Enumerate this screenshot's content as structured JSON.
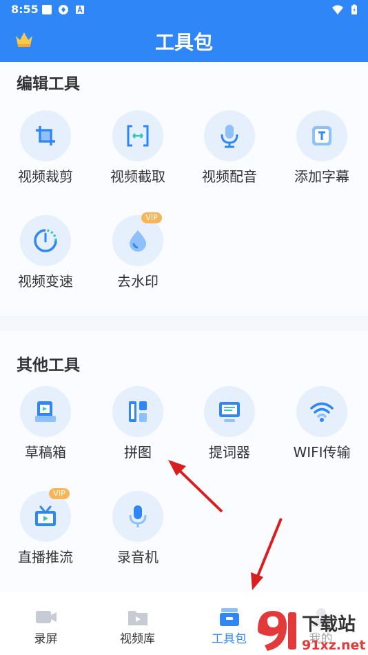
{
  "status": {
    "time": "8:55"
  },
  "header": {
    "title": "工具包"
  },
  "sections": [
    {
      "title": "编辑工具",
      "tools": [
        {
          "label": "视频裁剪",
          "icon": "crop-icon"
        },
        {
          "label": "视频截取",
          "icon": "trim-icon"
        },
        {
          "label": "视频配音",
          "icon": "microphone-icon"
        },
        {
          "label": "添加字幕",
          "icon": "subtitle-icon"
        },
        {
          "label": "视频变速",
          "icon": "speed-icon"
        },
        {
          "label": "去水印",
          "icon": "watermark-drop-icon",
          "badge": "VIP"
        }
      ]
    },
    {
      "title": "其他工具",
      "tools": [
        {
          "label": "草稿箱",
          "icon": "draft-box-icon"
        },
        {
          "label": "拼图",
          "icon": "collage-icon"
        },
        {
          "label": "提词器",
          "icon": "teleprompter-icon"
        },
        {
          "label": "WIFI传输",
          "icon": "wifi-icon"
        },
        {
          "label": "直播推流",
          "icon": "live-tv-icon",
          "badge": "VIP"
        },
        {
          "label": "录音机",
          "icon": "recorder-mic-icon"
        }
      ]
    }
  ],
  "tabs": [
    {
      "label": "录屏",
      "icon": "camera-icon"
    },
    {
      "label": "视频库",
      "icon": "video-folder-icon"
    },
    {
      "label": "工具包",
      "icon": "toolbox-icon",
      "active": true
    },
    {
      "label": "我的",
      "icon": "profile-icon"
    }
  ],
  "watermark": {
    "text1": "下载站",
    "text2": "91xz.net"
  },
  "colors": {
    "primary": "#2f86f6",
    "vip": "#f7b55a",
    "accent_green": "#35c9b8"
  }
}
